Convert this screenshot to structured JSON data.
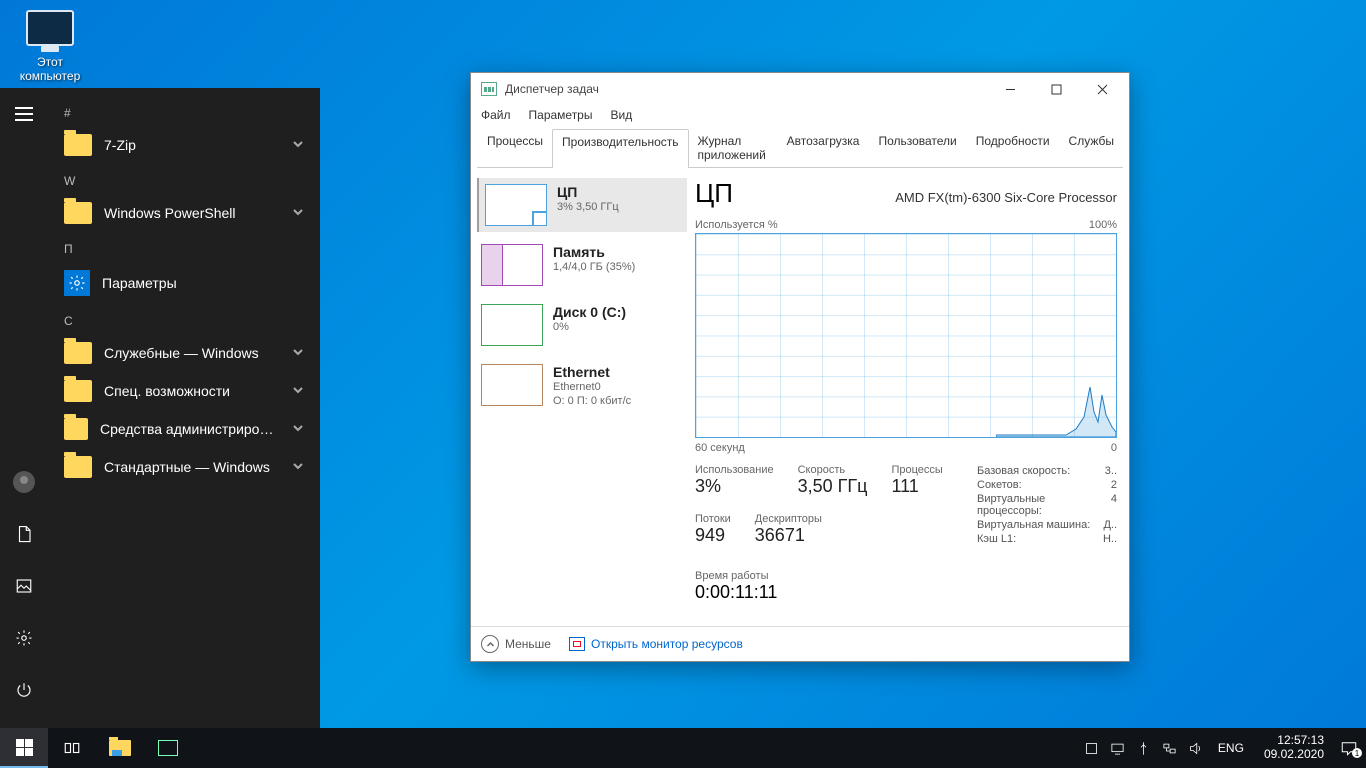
{
  "desktop": {
    "this_pc": "Этот\nкомпьютер"
  },
  "start_menu": {
    "groups": {
      "hash": "#",
      "w": "W",
      "p": "П",
      "s": "С"
    },
    "apps": {
      "sevenzip": "7-Zip",
      "powershell": "Windows PowerShell",
      "settings": "Параметры",
      "sys_windows": "Служебные — Windows",
      "accessibility": "Спец. возможности",
      "admin_tools": "Средства администрирования…",
      "accessories": "Стандартные — Windows"
    }
  },
  "task_manager": {
    "title": "Диспетчер задач",
    "menu": {
      "file": "Файл",
      "options": "Параметры",
      "view": "Вид"
    },
    "tabs": {
      "processes": "Процессы",
      "performance": "Производительность",
      "app_history": "Журнал приложений",
      "startup": "Автозагрузка",
      "users": "Пользователи",
      "details": "Подробности",
      "services": "Службы"
    },
    "list": {
      "cpu": {
        "title": "ЦП",
        "sub": "3%  3,50 ГГц"
      },
      "memory": {
        "title": "Память",
        "sub": "1,4/4,0 ГБ (35%)"
      },
      "disk": {
        "title": "Диск 0 (C:)",
        "sub": "0%"
      },
      "ethernet": {
        "title": "Ethernet",
        "sub1": "Ethernet0",
        "sub2": "О: 0  П: 0 кбит/с"
      }
    },
    "detail": {
      "heading": "ЦП",
      "model": "AMD FX(tm)-6300 Six-Core Processor",
      "y_label": "Используется %",
      "y_max": "100%",
      "x_left": "60 секунд",
      "x_right": "0",
      "usage_lbl": "Использование",
      "usage_val": "3%",
      "speed_lbl": "Скорость",
      "speed_val": "3,50 ГГц",
      "proc_lbl": "Процессы",
      "proc_val": "111",
      "threads_lbl": "Потоки",
      "threads_val": "949",
      "handles_lbl": "Дескрипторы",
      "handles_val": "36671",
      "uptime_lbl": "Время работы",
      "uptime_val": "0:00:11:11",
      "base_lbl": "Базовая скорость:",
      "base_val": "3..",
      "sockets_lbl": "Сокетов:",
      "sockets_val": "2",
      "vcpu_lbl": "Виртуальные процессоры:",
      "vcpu_val": "4",
      "vm_lbl": "Виртуальная машина:",
      "vm_val": "Д..",
      "l1_lbl": "Кэш L1:",
      "l1_val": "Н.."
    },
    "footer": {
      "fewer": "Меньше",
      "resmon": "Открыть монитор ресурсов"
    }
  },
  "taskbar": {
    "lang": "ENG",
    "time": "12:57:13",
    "date": "09.02.2020",
    "notif_count": "1"
  },
  "chart_data": {
    "type": "line",
    "title": "ЦП — Используется %",
    "xlabel": "60 секунд → 0",
    "ylabel": "Используется %",
    "ylim": [
      0,
      100
    ],
    "x_seconds_ago": [
      60,
      55,
      50,
      45,
      40,
      35,
      30,
      25,
      20,
      15,
      12,
      10,
      8,
      6,
      5,
      4,
      3,
      2,
      1,
      0
    ],
    "values": [
      1,
      1,
      1,
      1,
      1,
      1,
      1,
      1,
      1,
      1,
      2,
      3,
      8,
      25,
      18,
      10,
      22,
      14,
      6,
      3
    ]
  }
}
